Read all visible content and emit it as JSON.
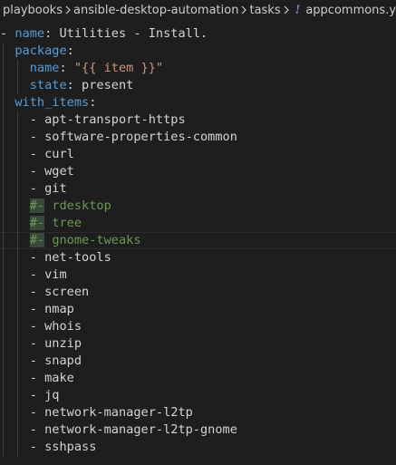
{
  "breadcrumb": {
    "items": [
      "playbooks",
      "ansible-desktop-automation",
      "tasks"
    ],
    "file_icon": "!",
    "file_name": "appcommons.yml"
  },
  "yaml": {
    "task_dash": "-",
    "name_key": "name",
    "name_value": "Utilities - Install.",
    "package_key": "package",
    "pkg_name_key": "name",
    "pkg_name_value": "\"{{ item }}\"",
    "state_key": "state",
    "state_value": "present",
    "with_items_key": "with_items",
    "items": [
      {
        "text": "apt-transport-https",
        "commented": false
      },
      {
        "text": "software-properties-common",
        "commented": false
      },
      {
        "text": "curl",
        "commented": false
      },
      {
        "text": "wget",
        "commented": false
      },
      {
        "text": "git",
        "commented": false
      },
      {
        "text": "rdesktop",
        "commented": true
      },
      {
        "text": "tree",
        "commented": true
      },
      {
        "text": "gnome-tweaks",
        "commented": true
      },
      {
        "text": "net-tools",
        "commented": false
      },
      {
        "text": "vim",
        "commented": false
      },
      {
        "text": "screen",
        "commented": false
      },
      {
        "text": "nmap",
        "commented": false
      },
      {
        "text": "whois",
        "commented": false
      },
      {
        "text": "unzip",
        "commented": false
      },
      {
        "text": "snapd",
        "commented": false
      },
      {
        "text": "make",
        "commented": false
      },
      {
        "text": "jq",
        "commented": false
      },
      {
        "text": "network-manager-l2tp",
        "commented": false
      },
      {
        "text": "network-manager-l2tp-gnome",
        "commented": false
      },
      {
        "text": "sshpass",
        "commented": false
      }
    ],
    "item_dash": "-",
    "comment_marker": "#-"
  },
  "colors": {
    "background": "#1e1e1e",
    "key": "#569cd6",
    "string": "#ce9178",
    "comment": "#6a9955",
    "text": "#d4d4d4"
  }
}
